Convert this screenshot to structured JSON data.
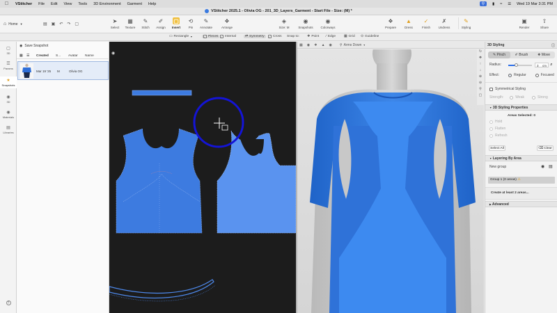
{
  "menubar": {
    "app_name": "VStitcher",
    "items": [
      "File",
      "Edit",
      "View",
      "Tools",
      "3D Environment",
      "Garment",
      "Help"
    ],
    "datetime": "Wed 19 Mar  3:31 PM"
  },
  "window": {
    "title": "VStitcher 2025.1 - Olivia OG - 201_3D_Layers_Garment - Start File - Size: (M) *"
  },
  "toolbar": {
    "home_label": "Home",
    "tools": [
      {
        "label": "Select",
        "icon": "cursor-icon"
      },
      {
        "label": "Texture",
        "icon": "texture-icon"
      },
      {
        "label": "Stitch",
        "icon": "stitch-icon"
      },
      {
        "label": "Assign",
        "icon": "assign-icon"
      },
      {
        "label": "Insert",
        "icon": "insert-icon",
        "active": true
      },
      {
        "label": "Pin",
        "icon": "pin-icon"
      },
      {
        "label": "Annotate",
        "icon": "annotate-icon"
      },
      {
        "label": "Arrange",
        "icon": "arrange-icon"
      },
      {
        "label": "Size: M",
        "icon": "size-icon"
      },
      {
        "label": "Snapshots",
        "icon": "snapshot-icon"
      },
      {
        "label": "Colorways",
        "icon": "colorway-icon"
      },
      {
        "label": "Prepare",
        "icon": "prepare-icon"
      },
      {
        "label": "Dress",
        "icon": "dress-icon"
      },
      {
        "label": "Finish",
        "icon": "finish-icon"
      },
      {
        "label": "Undress",
        "icon": "undress-icon"
      },
      {
        "label": "Styling",
        "icon": "styling-icon",
        "active": true
      },
      {
        "label": "Render",
        "icon": "render-icon"
      },
      {
        "label": "Share",
        "icon": "share-icon"
      }
    ]
  },
  "subtoolbar": {
    "shape": "Rectangle",
    "pieces": "Pieces",
    "internal": "Internal",
    "symmetry": "Symmetry",
    "cross": "Cross",
    "snap_to": "Snap to:",
    "point": "Point",
    "edge": "Edge",
    "grid": "Grid",
    "guideline": "Guideline",
    "camera_view": "Arms Down"
  },
  "left_nav": {
    "items": [
      {
        "label": "3D",
        "icon": "cube-icon"
      },
      {
        "label": "Params",
        "icon": "params-icon"
      },
      {
        "label": "Snapshots",
        "icon": "snapshot-icon",
        "active": true
      },
      {
        "label": "3D",
        "icon": "cube-icon"
      },
      {
        "label": "Materials",
        "icon": "materials-icon"
      },
      {
        "label": "Libraries",
        "icon": "library-icon"
      }
    ],
    "help": "?"
  },
  "snapshots": {
    "save_label": "Save Snapshot",
    "columns": [
      "Created",
      "S...",
      "Avatar",
      "Name"
    ],
    "rows": [
      {
        "created": "Mar 19 '25",
        "size": "M",
        "avatar": "Olivia OG",
        "name": ""
      }
    ]
  },
  "styling_panel": {
    "title": "3D Styling",
    "tabs": [
      "Pinch",
      "Brush",
      "Move"
    ],
    "radius_label": "Radius:",
    "radius_value": "3",
    "radius_unit": "cm",
    "radius_fraction": 0.35,
    "effect_label": "Effect:",
    "effect_options": [
      "Regular",
      "Focused"
    ],
    "symmetrical_label": "Symmetrical Styling",
    "strength_label": "Strength:",
    "strength_options": [
      "Weak",
      "Strong"
    ],
    "props_title": "3D Styling Properties",
    "areas_selected": "Areas Selected: 0",
    "mode_options": [
      "Hold",
      "Flatten",
      "Refresh"
    ],
    "select_all": "Select All",
    "clear": "Clear",
    "layering_title": "Layering By Area",
    "new_group": "New group",
    "group_label": "Group 1 (0 areas)",
    "create_hint": "Create at least 2 areas...",
    "advanced": "Advanced"
  },
  "colors": {
    "garment": "#3d7be0",
    "garment_light": "#5a93ef",
    "cursor_ring": "#1414d6",
    "accent_yellow": "#f2c240"
  }
}
